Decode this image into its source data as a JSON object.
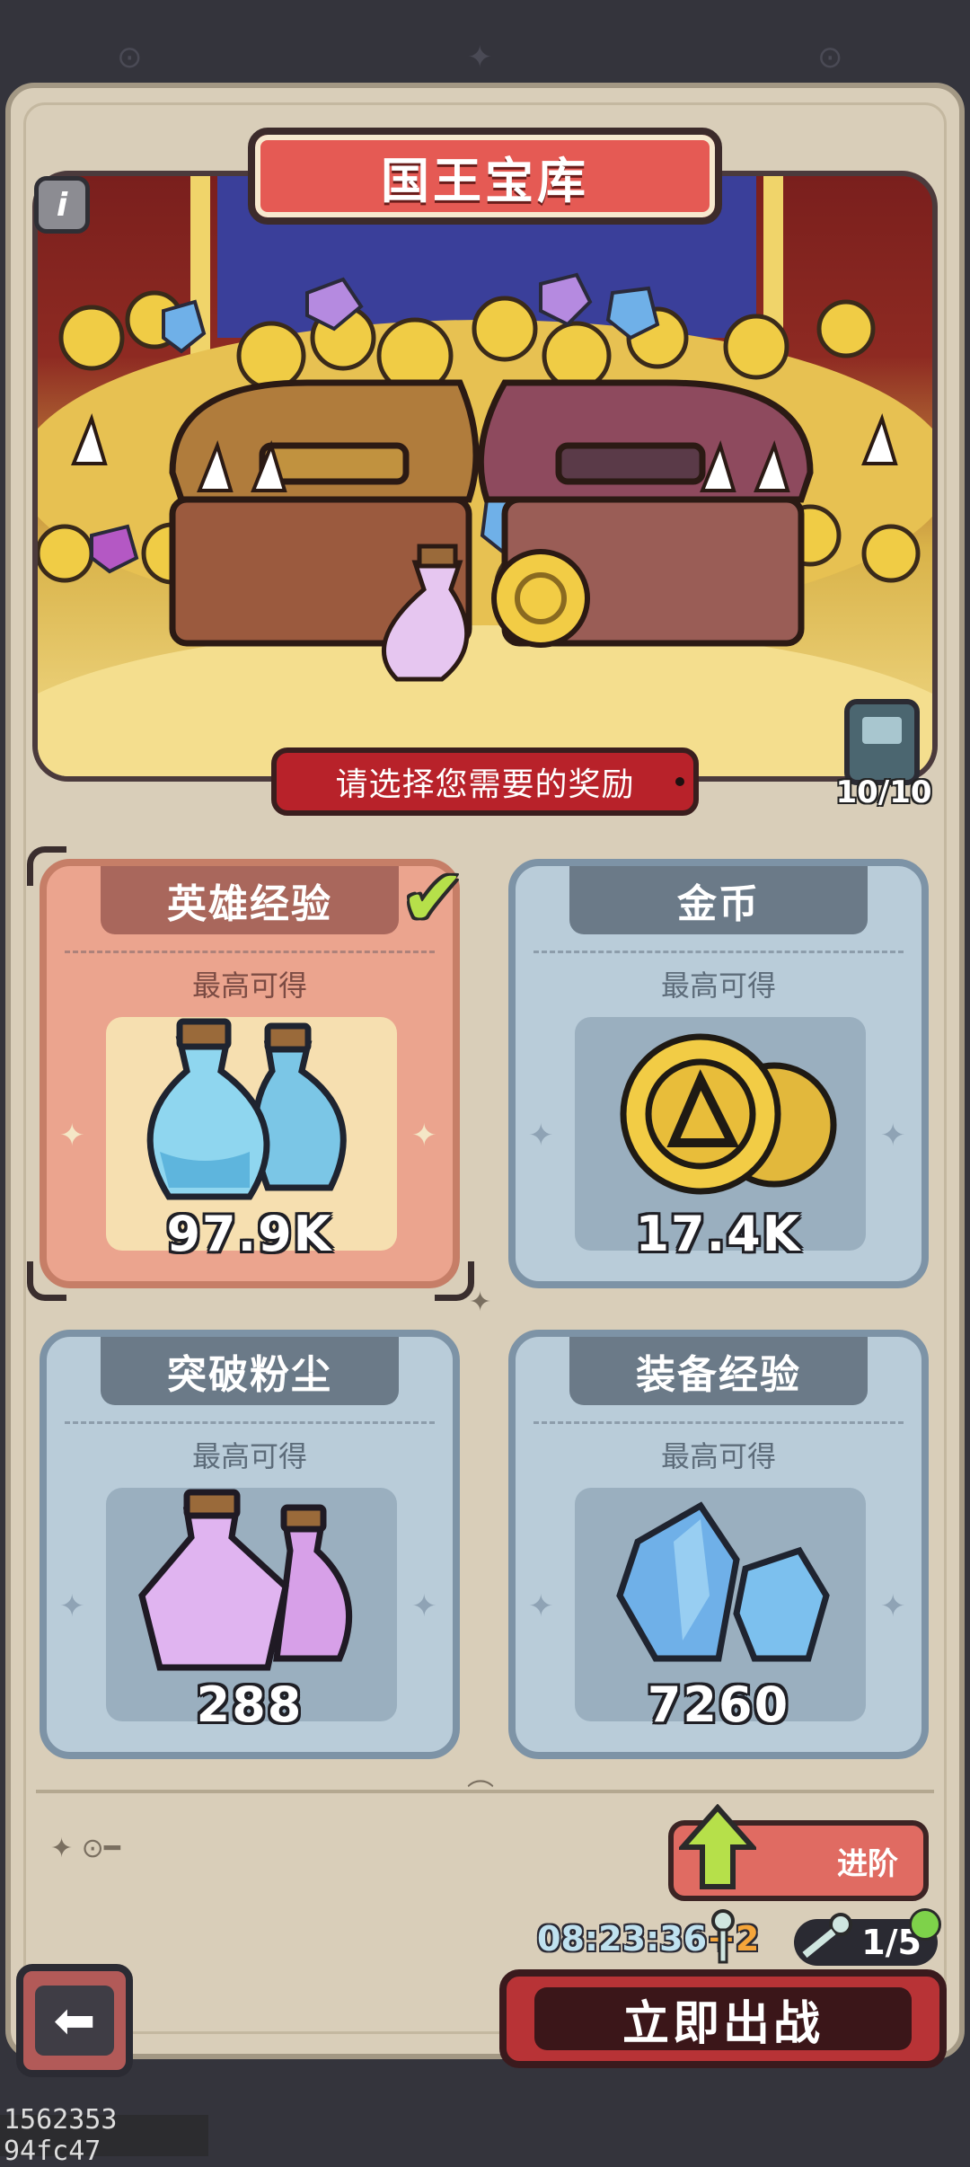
{
  "header": {
    "title": "国王宝库",
    "subtitle": "请选择您需要的奖励",
    "book_counter": "10/10"
  },
  "rewards": [
    {
      "name": "英雄经验",
      "subtitle": "最高可得",
      "value": "97.9K",
      "selected": true,
      "icon": "blue-potion-icon"
    },
    {
      "name": "金币",
      "subtitle": "最高可得",
      "value": "17.4K",
      "selected": false,
      "icon": "gold-coins-icon"
    },
    {
      "name": "突破粉尘",
      "subtitle": "最高可得",
      "value": "288",
      "selected": false,
      "icon": "purple-potion-icon"
    },
    {
      "name": "装备经验",
      "subtitle": "最高可得",
      "value": "7260",
      "selected": false,
      "icon": "blue-crystal-icon"
    }
  ],
  "footer": {
    "advance_label": "进阶",
    "timer": "08:23:36",
    "timer_bonus": "+2",
    "keys": "1/5",
    "fight_label": "立即出战",
    "screen_id": "1562353 94fc47"
  },
  "colors": {
    "background": "#34343c",
    "panel": "#d9ceb9",
    "title_banner": "#e55a54",
    "subtitle_banner": "#b8222a",
    "selected_card": "#eba48e",
    "card": "#b9ccd9",
    "fight_button": "#b83336",
    "check": "#b6e04a",
    "advance_arrow": "#b6e04a"
  }
}
